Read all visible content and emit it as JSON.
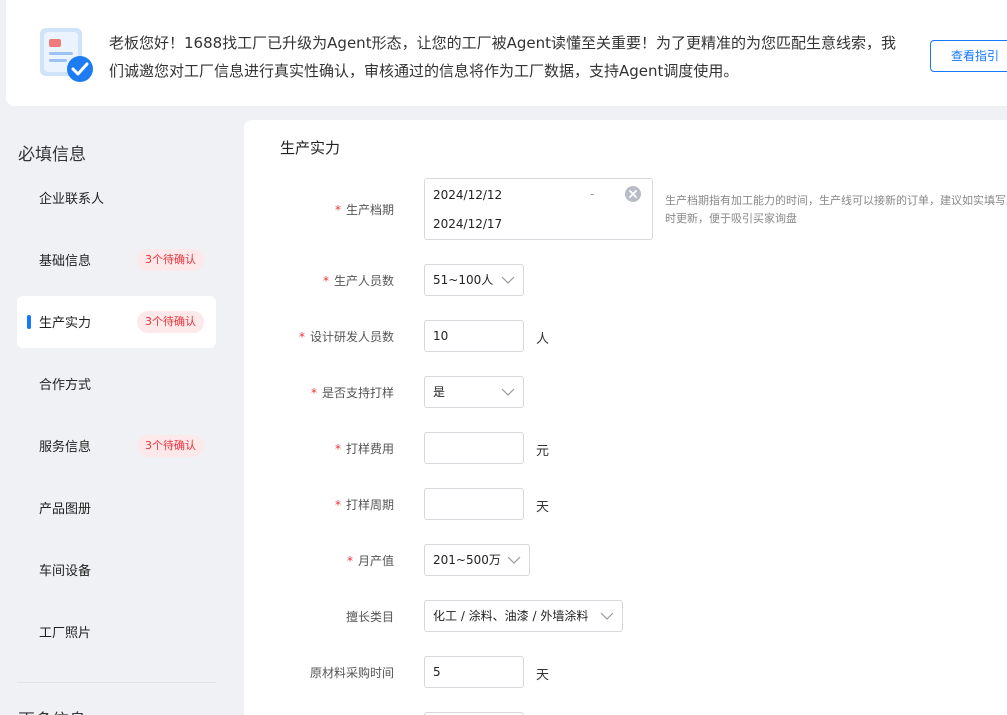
{
  "banner": {
    "message": "老板您好！1688找工厂已升级为Agent形态，让您的工厂被Agent读懂至关重要！为了更精准的为您匹配生意线索，我们诚邀您对工厂信息进行真实性确认，审核通过的信息将作为工厂数据，支持Agent调度使用。",
    "guide_button": "查看指引",
    "icon": "verified-document-icon"
  },
  "sidebar": {
    "required_title": "必填信息",
    "items": [
      {
        "label": "企业联系人",
        "badge": ""
      },
      {
        "label": "基础信息",
        "badge": "3个待确认"
      },
      {
        "label": "生产实力",
        "badge": "3个待确认",
        "active": true
      },
      {
        "label": "合作方式",
        "badge": ""
      },
      {
        "label": "服务信息",
        "badge": "3个待确认"
      },
      {
        "label": "产品图册",
        "badge": ""
      },
      {
        "label": "车间设备",
        "badge": ""
      },
      {
        "label": "工厂照片",
        "badge": ""
      }
    ],
    "more_title": "更多信息"
  },
  "form": {
    "section_title": "生产实力",
    "production_period": {
      "label": "生产档期",
      "start": "2024/12/12",
      "separator": "-",
      "end": "2024/12/17",
      "hint": "生产档期指有加工能力的时间，生产线可以接新的订单，建议如实填写及时更新，便于吸引买家询盘"
    },
    "staff_count": {
      "label": "生产人员数",
      "value": "51~100人"
    },
    "design_staff": {
      "label": "设计研发人员数",
      "value": "10",
      "unit": "人"
    },
    "sampling_support": {
      "label": "是否支持打样",
      "value": "是"
    },
    "sampling_fee": {
      "label": "打样费用",
      "value": "",
      "unit": "元"
    },
    "sampling_cycle": {
      "label": "打样周期",
      "value": "",
      "unit": "天"
    },
    "monthly_output": {
      "label": "月产值",
      "value": "201~500万"
    },
    "category": {
      "label": "擅长类目",
      "value": "化工 / 涂料、油漆 / 外墙涂料"
    },
    "material_time": {
      "label": "原材料采购时间",
      "value": "5",
      "unit": "天"
    }
  },
  "colors": {
    "accent": "#1677ff",
    "required": "#e8343c",
    "badge_bg": "#fde8ea"
  }
}
